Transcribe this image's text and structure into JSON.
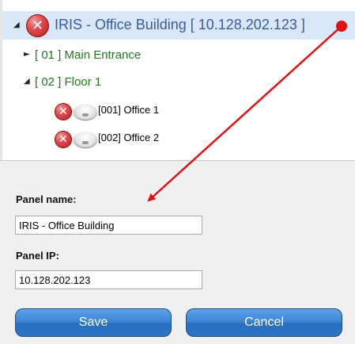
{
  "tree": {
    "root": {
      "label": "IRIS - Office Building [ 10.128.202.123 ]",
      "status_icon": "error-x-icon"
    },
    "zones": [
      {
        "label": "[ 01 ] Main Entrance",
        "expanded": false
      },
      {
        "label": "[ 02 ] Floor 1",
        "expanded": true
      }
    ],
    "devices": [
      {
        "label": "[001] Office 1",
        "status_icon": "error-x-icon",
        "device_icon": "smoke-detector-icon"
      },
      {
        "label": "[002] Office 2",
        "status_icon": "error-x-icon",
        "device_icon": "smoke-detector-icon"
      }
    ],
    "expanded_glyph": "◢",
    "collapsed_glyph": "►",
    "error_glyph": "✕"
  },
  "form": {
    "panel_name_label": "Panel name:",
    "panel_name_value": "IRIS - Office Building",
    "panel_ip_label": "Panel IP:",
    "panel_ip_value": "10.128.202.123"
  },
  "buttons": {
    "save": "Save",
    "cancel": "Cancel"
  },
  "colors": {
    "root_text": "#3b5ba5",
    "zone_text": "#1e7a1e",
    "selection": "#d9e8f7",
    "button": "#3b85d6",
    "arrow": "#e01010"
  }
}
